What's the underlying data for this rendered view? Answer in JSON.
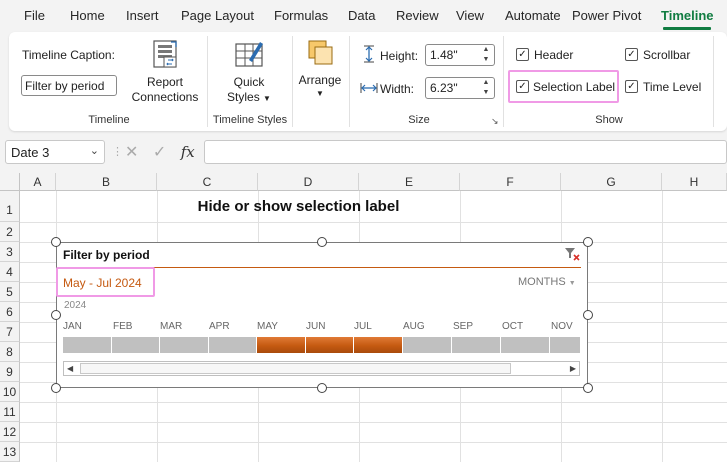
{
  "tabs": [
    "File",
    "Home",
    "Insert",
    "Page Layout",
    "Formulas",
    "Data",
    "Review",
    "View",
    "Automate",
    "Power Pivot",
    "Timeline"
  ],
  "active_tab": "Timeline",
  "ribbon": {
    "timeline_group": {
      "caption_label": "Timeline Caption:",
      "caption_value": "Filter by period",
      "report_connections": [
        "Report",
        "Connections"
      ],
      "label": "Timeline"
    },
    "styles_group": {
      "quick_styles": [
        "Quick",
        "Styles"
      ],
      "label": "Timeline Styles"
    },
    "arrange": {
      "label": "Arrange"
    },
    "size_group": {
      "height_label": "Height:",
      "height_value": "1.48\"",
      "width_label": "Width:",
      "width_value": "6.23\"",
      "label": "Size"
    },
    "show_group": {
      "header": "Header",
      "scrollbar": "Scrollbar",
      "selection_label": "Selection Label",
      "time_level": "Time Level",
      "label": "Show"
    }
  },
  "formula_bar": {
    "name_box": "Date 3",
    "fx": "fx",
    "formula": ""
  },
  "sheet": {
    "columns": [
      "A",
      "B",
      "C",
      "D",
      "E",
      "F",
      "G",
      "H"
    ],
    "rows": [
      "1",
      "2",
      "3",
      "4",
      "5",
      "6",
      "7",
      "8",
      "9",
      "10",
      "11",
      "12",
      "13"
    ],
    "title": "Hide or show selection label"
  },
  "timeline": {
    "caption": "Filter by period",
    "selection_label": "May - Jul 2024",
    "time_level": "MONTHS",
    "year": "2024",
    "months": [
      "JAN",
      "FEB",
      "MAR",
      "APR",
      "MAY",
      "JUN",
      "JUL",
      "AUG",
      "SEP",
      "OCT",
      "NOV"
    ],
    "selected_months": [
      "MAY",
      "JUN",
      "JUL"
    ]
  },
  "colors": {
    "accent": "#107c41",
    "selection": "#c55a11",
    "highlight": "#f09ae6"
  }
}
